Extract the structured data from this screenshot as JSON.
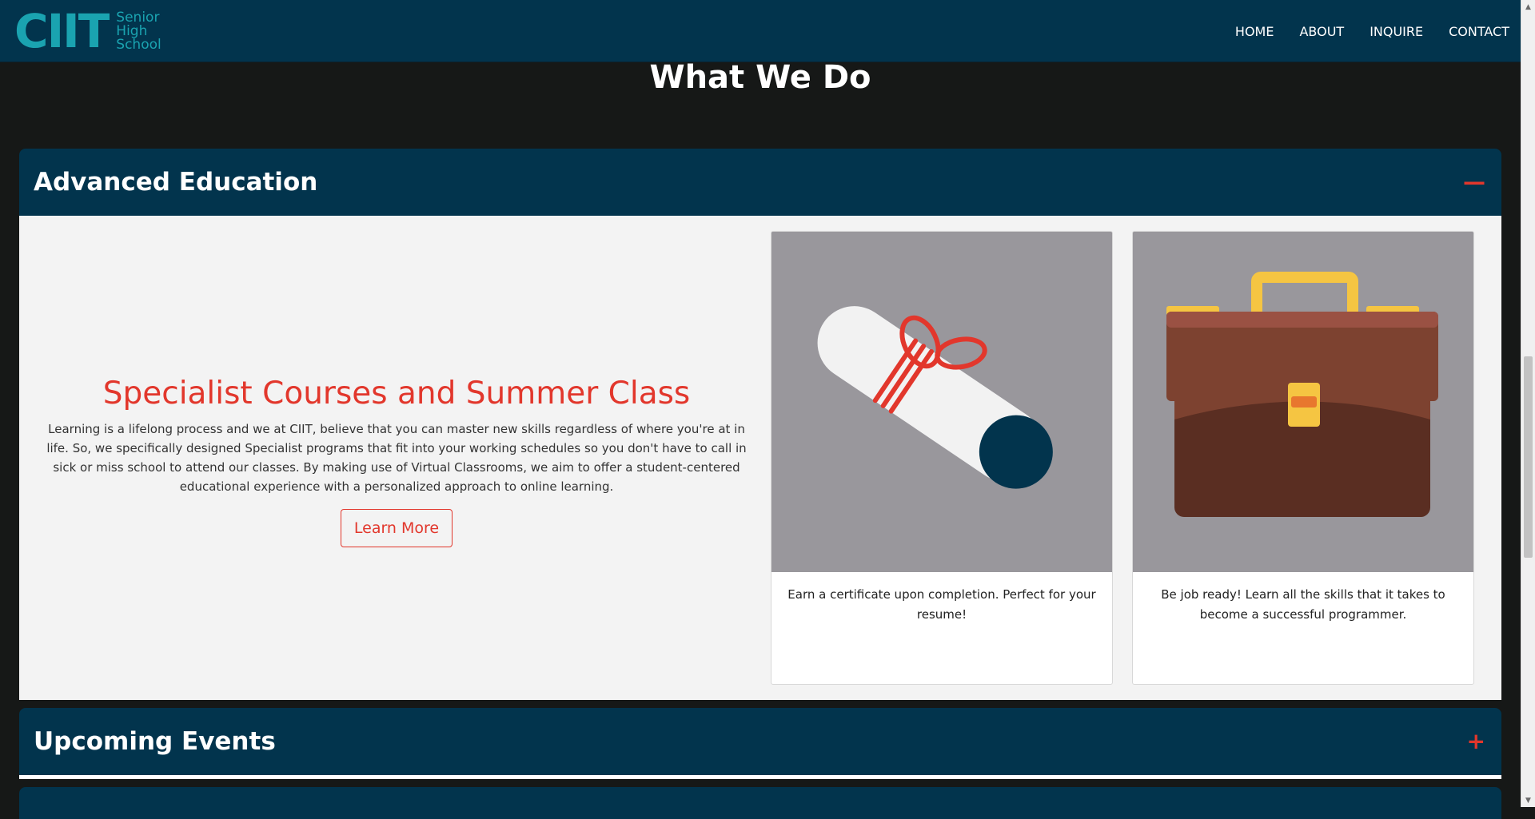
{
  "navbar": {
    "logo_mark": "CIIT",
    "logo_line1": "Senior",
    "logo_line2": "High",
    "logo_line3": "School",
    "links": [
      "HOME",
      "ABOUT",
      "INQUIRE",
      "CONTACT"
    ]
  },
  "section": {
    "title": "What We Do"
  },
  "accordion": [
    {
      "title": "Advanced Education",
      "toggle": "—",
      "expanded": true
    },
    {
      "title": "Upcoming Events",
      "toggle": "+",
      "expanded": false
    }
  ],
  "intro": {
    "heading": "Specialist Courses and Summer Class",
    "body": "Learning is a lifelong process and we at CIIT, believe that you can master new skills regardless of where you're at in life. So, we specifically designed Specialist programs that fit into your working schedules so you don't have to call in sick or miss school to attend our classes. By making use of Virtual Classrooms, we aim to offer a student-centered educational experience with a personalized approach to online learning.",
    "button_label": "Learn More"
  },
  "cards": [
    {
      "icon": "diploma-icon",
      "text": "Earn a certificate upon completion. Perfect for your resume!"
    },
    {
      "icon": "briefcase-icon",
      "text": "Be job ready! Learn all the skills that it takes to become a successful programmer."
    }
  ],
  "colors": {
    "navy": "#02344d",
    "accent_red": "#e2372c",
    "logo_teal": "#1aa3b0",
    "card_image_bg": "#99979c",
    "page_bg": "#161817"
  }
}
